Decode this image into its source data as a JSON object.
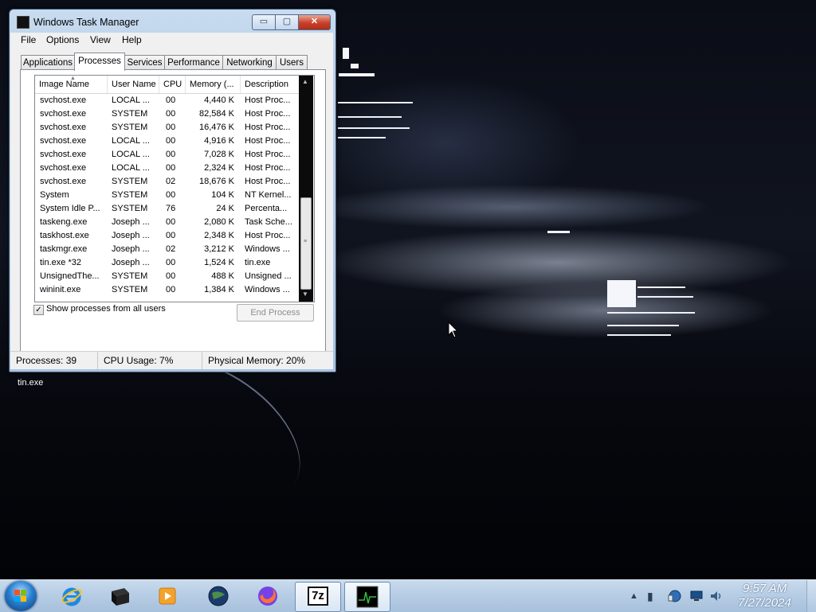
{
  "window": {
    "title": "Windows Task Manager",
    "min_glyph": "▭",
    "max_glyph": "▢",
    "close_glyph": "✕"
  },
  "menu": [
    "File",
    "Options",
    "View",
    "Help"
  ],
  "tabs": [
    {
      "label": "Applications",
      "active": false
    },
    {
      "label": "Processes",
      "active": true
    },
    {
      "label": "Services",
      "active": false
    },
    {
      "label": "Performance",
      "active": false
    },
    {
      "label": "Networking",
      "active": false
    },
    {
      "label": "Users",
      "active": false
    }
  ],
  "columns": [
    "Image Name",
    "User Name",
    "CPU",
    "Memory (...",
    "Description"
  ],
  "processes": [
    {
      "image": "svchost.exe",
      "user": "LOCAL ...",
      "cpu": "00",
      "memory": "4,440 K",
      "description": "Host Proc..."
    },
    {
      "image": "svchost.exe",
      "user": "SYSTEM",
      "cpu": "00",
      "memory": "82,584 K",
      "description": "Host Proc..."
    },
    {
      "image": "svchost.exe",
      "user": "SYSTEM",
      "cpu": "00",
      "memory": "16,476 K",
      "description": "Host Proc..."
    },
    {
      "image": "svchost.exe",
      "user": "LOCAL ...",
      "cpu": "00",
      "memory": "4,916 K",
      "description": "Host Proc..."
    },
    {
      "image": "svchost.exe",
      "user": "LOCAL ...",
      "cpu": "00",
      "memory": "7,028 K",
      "description": "Host Proc..."
    },
    {
      "image": "svchost.exe",
      "user": "LOCAL ...",
      "cpu": "00",
      "memory": "2,324 K",
      "description": "Host Proc..."
    },
    {
      "image": "svchost.exe",
      "user": "SYSTEM",
      "cpu": "02",
      "memory": "18,676 K",
      "description": "Host Proc..."
    },
    {
      "image": "System",
      "user": "SYSTEM",
      "cpu": "00",
      "memory": "104 K",
      "description": "NT Kernel..."
    },
    {
      "image": "System Idle P...",
      "user": "SYSTEM",
      "cpu": "76",
      "memory": "24 K",
      "description": "Percenta..."
    },
    {
      "image": "taskeng.exe",
      "user": "Joseph ...",
      "cpu": "00",
      "memory": "2,080 K",
      "description": "Task Sche..."
    },
    {
      "image": "taskhost.exe",
      "user": "Joseph ...",
      "cpu": "00",
      "memory": "2,348 K",
      "description": "Host Proc..."
    },
    {
      "image": "taskmgr.exe",
      "user": "Joseph ...",
      "cpu": "02",
      "memory": "3,212 K",
      "description": "Windows ..."
    },
    {
      "image": "tin.exe *32",
      "user": "Joseph ...",
      "cpu": "00",
      "memory": "1,524 K",
      "description": "tin.exe"
    },
    {
      "image": "UnsignedThe...",
      "user": "SYSTEM",
      "cpu": "00",
      "memory": "488 K",
      "description": "Unsigned ..."
    },
    {
      "image": "wininit.exe",
      "user": "SYSTEM",
      "cpu": "00",
      "memory": "1,384 K",
      "description": "Windows ..."
    }
  ],
  "show_all_users": {
    "label": "Show processes from all users",
    "checked": true,
    "check_glyph": "✓"
  },
  "end_process_label": "End Process",
  "status": {
    "processes": "Processes: 39",
    "cpu_usage": "CPU Usage: 7%",
    "physical_memory": "Physical Memory: 20%"
  },
  "desktop": {
    "icon_label": "tin.exe"
  },
  "taskbar": {
    "items": [
      {
        "name": "internet-explorer",
        "active": false
      },
      {
        "name": "black-box-app",
        "active": false
      },
      {
        "name": "media-player",
        "active": false
      },
      {
        "name": "globe-app",
        "active": false
      },
      {
        "name": "firefox",
        "active": false
      },
      {
        "name": "7-zip",
        "active": true,
        "text": "7z"
      },
      {
        "name": "task-manager",
        "active": true
      }
    ],
    "tray": [
      "chevron-up-icon",
      "battery-icon",
      "network-globe-icon",
      "monitor-icon",
      "volume-icon"
    ],
    "clock": {
      "time": "9:57 AM",
      "date": "7/27/2024"
    }
  }
}
